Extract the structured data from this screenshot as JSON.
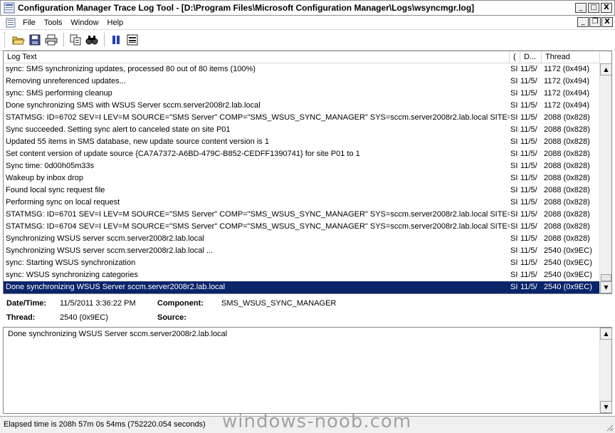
{
  "window": {
    "title": "Configuration Manager Trace Log Tool - [D:\\Program Files\\Microsoft Configuration Manager\\Logs\\wsyncmgr.log]",
    "minimize": "_",
    "maximize": "□",
    "close": "X",
    "mdi_minimize": "_",
    "mdi_restore": "❐",
    "mdi_close": "X"
  },
  "menu": {
    "items": [
      {
        "label": "File"
      },
      {
        "label": "Tools"
      },
      {
        "label": "Window"
      },
      {
        "label": "Help"
      }
    ]
  },
  "toolbar": {
    "icons": [
      "open-folder-icon",
      "save-icon",
      "print-icon",
      "copy-icon",
      "find-icon",
      "pause-icon",
      "highlight-icon"
    ]
  },
  "log": {
    "columns": [
      "Log Text",
      "(",
      "D...",
      "Thread"
    ],
    "rows": [
      {
        "text": "sync: SMS synchronizing updates, processed 80 out of 80 items (100%)",
        "comp": "SI",
        "date": "11/5/",
        "thread": "1172 (0x494)"
      },
      {
        "text": "Removing unreferenced updates...",
        "comp": "SI",
        "date": "11/5/",
        "thread": "1172 (0x494)"
      },
      {
        "text": "sync: SMS performing cleanup",
        "comp": "SI",
        "date": "11/5/",
        "thread": "1172 (0x494)"
      },
      {
        "text": "Done synchronizing SMS with WSUS Server sccm.server2008r2.lab.local",
        "comp": "SI",
        "date": "11/5/",
        "thread": "1172 (0x494)"
      },
      {
        "text": "STATMSG: ID=6702 SEV=I LEV=M SOURCE=\"SMS Server\" COMP=\"SMS_WSUS_SYNC_MANAGER\" SYS=sccm.server2008r2.lab.local SITE=...",
        "comp": "SI",
        "date": "11/5/",
        "thread": "2088 (0x828)"
      },
      {
        "text": "Sync succeeded. Setting sync alert to canceled state on site P01",
        "comp": "SI",
        "date": "11/5/",
        "thread": "2088 (0x828)"
      },
      {
        "text": "Updated 55 items in SMS database, new update source content version is 1",
        "comp": "SI",
        "date": "11/5/",
        "thread": "2088 (0x828)"
      },
      {
        "text": "Set content version of update source {CA7A7372-A6BD-479C-B852-CEDFF1390741} for site P01 to 1",
        "comp": "SI",
        "date": "11/5/",
        "thread": "2088 (0x828)"
      },
      {
        "text": "Sync time: 0d00h05m33s",
        "comp": "SI",
        "date": "11/5/",
        "thread": "2088 (0x828)"
      },
      {
        "text": "Wakeup by inbox drop",
        "comp": "SI",
        "date": "11/5/",
        "thread": "2088 (0x828)"
      },
      {
        "text": "Found local sync request file",
        "comp": "SI",
        "date": "11/5/",
        "thread": "2088 (0x828)"
      },
      {
        "text": "Performing sync on local request",
        "comp": "SI",
        "date": "11/5/",
        "thread": "2088 (0x828)"
      },
      {
        "text": "STATMSG: ID=6701 SEV=I LEV=M SOURCE=\"SMS Server\" COMP=\"SMS_WSUS_SYNC_MANAGER\" SYS=sccm.server2008r2.lab.local SITE=...",
        "comp": "SI",
        "date": "11/5/",
        "thread": "2088 (0x828)"
      },
      {
        "text": "STATMSG: ID=6704 SEV=I LEV=M SOURCE=\"SMS Server\" COMP=\"SMS_WSUS_SYNC_MANAGER\" SYS=sccm.server2008r2.lab.local SITE=...",
        "comp": "SI",
        "date": "11/5/",
        "thread": "2088 (0x828)"
      },
      {
        "text": "Synchronizing WSUS server sccm.server2008r2.lab.local",
        "comp": "SI",
        "date": "11/5/",
        "thread": "2088 (0x828)"
      },
      {
        "text": "Synchronizing WSUS server sccm.server2008r2.lab.local ...",
        "comp": "SI",
        "date": "11/5/",
        "thread": "2540 (0x9EC)"
      },
      {
        "text": "sync: Starting WSUS synchronization",
        "comp": "SI",
        "date": "11/5/",
        "thread": "2540 (0x9EC)"
      },
      {
        "text": "sync: WSUS synchronizing categories",
        "comp": "SI",
        "date": "11/5/",
        "thread": "2540 (0x9EC)"
      },
      {
        "text": "Done synchronizing WSUS Server sccm.server2008r2.lab.local",
        "comp": "SI",
        "date": "11/5/",
        "thread": "2540 (0x9EC)",
        "selected": true
      }
    ]
  },
  "details": {
    "datetime_label": "Date/Time:",
    "datetime_value": "11/5/2011 3:36:22 PM",
    "component_label": "Component:",
    "component_value": "SMS_WSUS_SYNC_MANAGER",
    "thread_label": "Thread:",
    "thread_value": "2540 (0x9EC)",
    "source_label": "Source:",
    "source_value": ""
  },
  "message": "Done synchronizing WSUS Server sccm.server2008r2.lab.local",
  "status": "Elapsed time is 208h 57m 0s 54ms (752220.054 seconds)",
  "watermark": "windows-noob.com",
  "colors": {
    "selection": "#0a246a",
    "pause_icon": "#1e3fbf"
  }
}
